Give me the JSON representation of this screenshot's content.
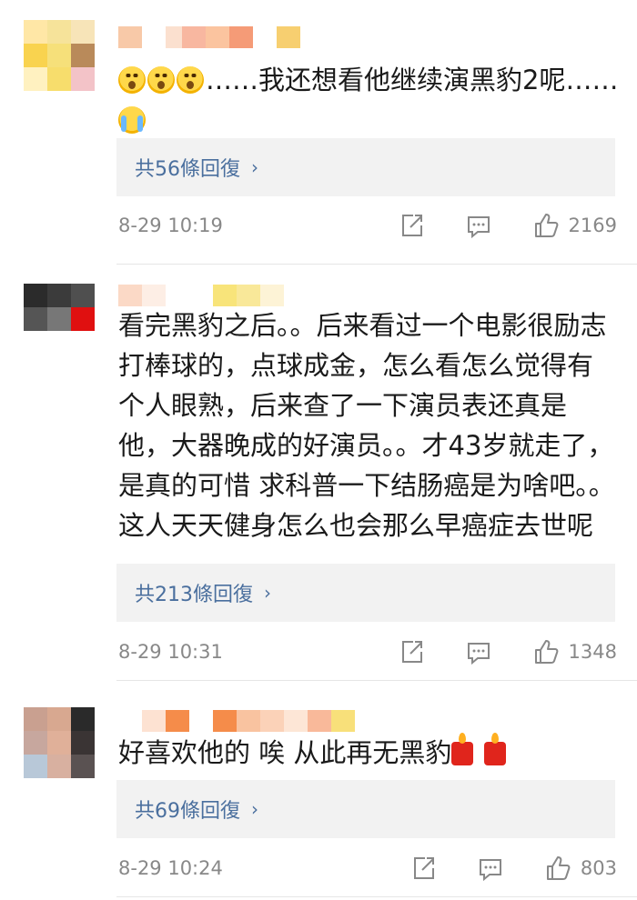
{
  "comments": [
    {
      "text_prefix": "……我还想看他继续演黑豹2呢……",
      "reply_label": "共56條回復",
      "time": "8-29 10:19",
      "likes": "2169"
    },
    {
      "text": "看完黑豹之后。。后来看过一个电影很励志打棒球的，点球成金，怎么看怎么觉得有个人眼熟，后来查了一下演员表还真是他，大器晚成的好演员。。才43岁就走了，是真的可惜  求科普一下结肠癌是为啥吧。。这人天天健身怎么也会那么早癌症去世呢",
      "reply_label": "共213條回復",
      "time": "8-29 10:31",
      "likes": "1348"
    },
    {
      "text": "好喜欢他的 唉 从此再无黑豹",
      "reply_label": "共69條回復",
      "time": "8-29 10:24",
      "likes": "803"
    }
  ],
  "icons": {
    "emoji_shock": "astonished-emoji-icon",
    "emoji_cry": "crying-emoji-icon",
    "emoji_candle": "candle-emoji-icon",
    "chevron": "chevron-right-icon",
    "share": "share-icon",
    "comment": "comment-icon",
    "like": "thumbs-up-icon"
  },
  "colors": {
    "link": "#4a6f9e",
    "meta": "#888888",
    "reply_bg": "#f2f2f2"
  }
}
